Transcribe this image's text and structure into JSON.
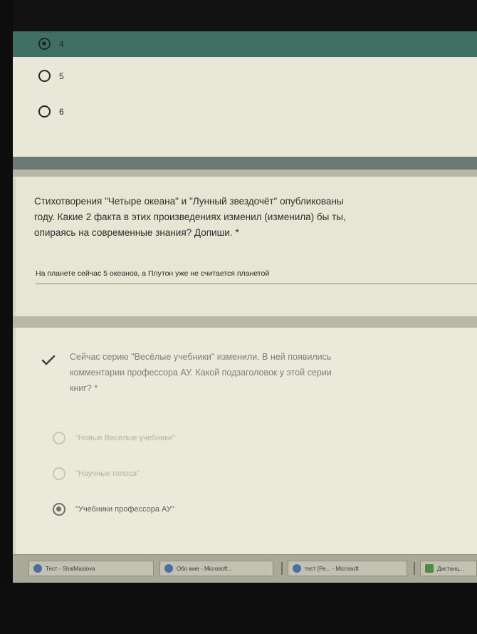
{
  "previous_question": {
    "options": [
      {
        "label": "4",
        "selected": true
      },
      {
        "label": "5",
        "selected": false
      },
      {
        "label": "6",
        "selected": false
      }
    ]
  },
  "text_question": {
    "title": "Стихотворения \"Четыре океана\" и \"Лунный звездочёт\" опубликованы\nгоду. Какие 2 факта в этих произведениях изменил (изменила) бы ты,\nопираясь на современные знания? Допиши. *",
    "answer": "На планете сейчас 5 океанов, а Плутон уже не считается планетой"
  },
  "graded_question": {
    "title": "Сейчас серию \"Весёлые учебники\" изменили. В ней появились\nкомментарии профессора АУ. Какой подзаголовок у этой серии\nкниг? *",
    "options": [
      {
        "label": "\"Новые Весёлые учебники\"",
        "selected": false
      },
      {
        "label": "\"Научные голоса\"",
        "selected": false
      },
      {
        "label": "\"Учебники профессора АУ\"",
        "selected": true
      }
    ]
  },
  "taskbar": {
    "items": [
      {
        "label": "Тест - ShalMaslova",
        "icon": "browser-icon"
      },
      {
        "label": "Обо мне - Microsoft...",
        "icon": "browser-icon"
      },
      {
        "label": "тест [Ре... - Microsoft",
        "icon": "browser-icon"
      },
      {
        "label": "Дистанц...",
        "icon": "app-icon"
      }
    ]
  },
  "colors": {
    "selected_row": "#3f6e63",
    "card_background": "#e9e7d7",
    "page_background": "#b9b8a6",
    "check_mark": "#3b4a44"
  }
}
